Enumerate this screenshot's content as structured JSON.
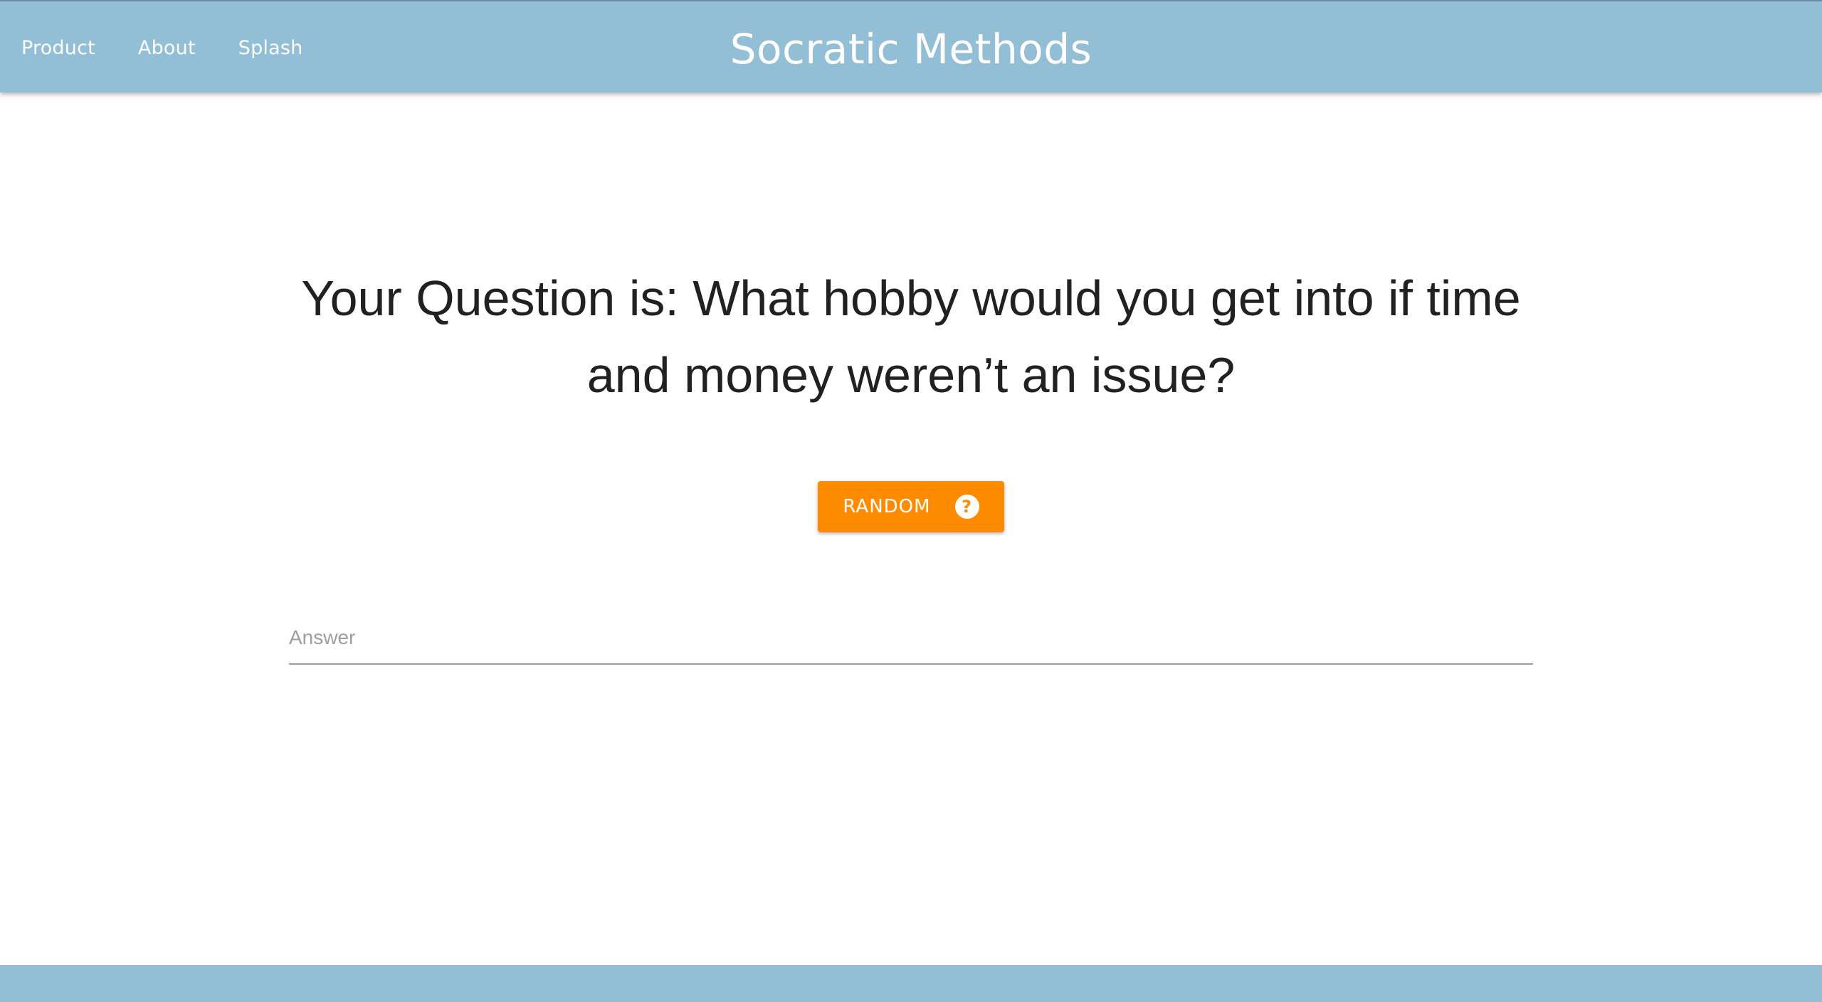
{
  "header": {
    "title": "Socratic Methods",
    "nav": [
      {
        "label": "Product"
      },
      {
        "label": "About"
      },
      {
        "label": "Splash"
      }
    ]
  },
  "main": {
    "question": "Your Question is: What hobby would you get into if time and money weren’t an issue?",
    "random_button": {
      "label": "RANDOM",
      "icon": "help-circle-icon"
    },
    "answer": {
      "placeholder": "Answer",
      "value": ""
    }
  },
  "colors": {
    "header": "#92bfd6",
    "accent": "#ff8c00",
    "text": "#212121"
  }
}
